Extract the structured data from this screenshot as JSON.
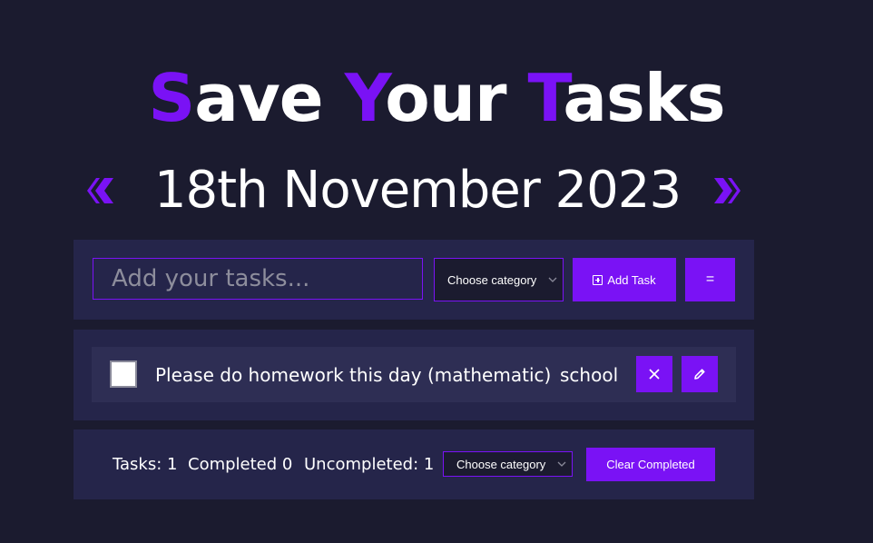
{
  "header": {
    "title": {
      "word1_initial": "S",
      "word1_rest": "ave ",
      "word2_initial": "Y",
      "word2_rest": "our ",
      "word3_initial": "T",
      "word3_rest": "asks"
    },
    "date": "18th November 2023",
    "prev_icon": "chevron-left-icon",
    "next_icon": "chevron-right-icon"
  },
  "input_bar": {
    "placeholder": "Add your tasks...",
    "value": "",
    "category_select": "Choose category",
    "add_button_label": "Add Task",
    "add_button_icon": "plus-square-icon",
    "menu_button_label": "="
  },
  "tasks": [
    {
      "text": "Please do homework this day (mathematic)",
      "category": "school",
      "completed": false,
      "delete_icon": "close-icon",
      "edit_icon": "pencil-icon"
    }
  ],
  "footer": {
    "tasks_count": "Tasks: 1",
    "completed_count": "Completed 0",
    "uncompleted_count": "Uncompleted: 1",
    "category_select": "Choose category",
    "clear_button_label": "Clear Completed"
  },
  "colors": {
    "background": "#1b1b2f",
    "panel": "#25254a",
    "accent": "#7a12f5",
    "text": "#ffffff"
  }
}
